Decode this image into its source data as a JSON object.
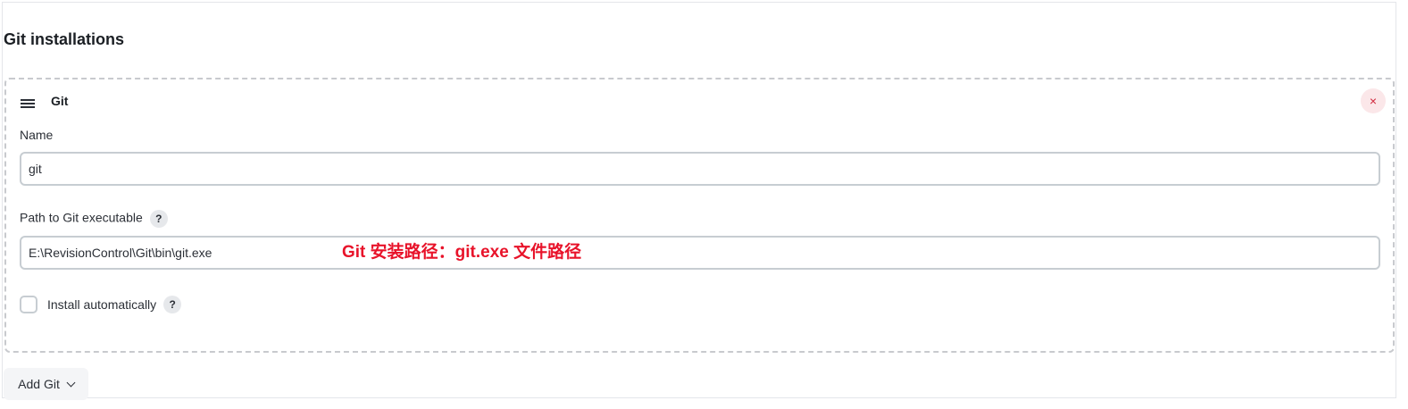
{
  "section": {
    "title": "Git installations"
  },
  "item": {
    "title": "Git",
    "delete_symbol": "×",
    "name": {
      "label": "Name",
      "value": "git"
    },
    "path": {
      "label": "Path to Git executable",
      "help": "?",
      "value": "E:\\RevisionControl\\Git\\bin\\git.exe"
    },
    "install": {
      "label": "Install automatically",
      "help": "?",
      "checked": false
    },
    "annotation": "Git 安装路径：git.exe 文件路径"
  },
  "add_button": {
    "label": "Add Git"
  },
  "colors": {
    "annotation": "#e8132a",
    "delete_icon": "#d0273c",
    "delete_bg": "#fbe7e9",
    "border": "#c7cdd2"
  },
  "icons": {
    "drag": "drag-handle-icon",
    "delete": "close-icon",
    "help": "help-icon",
    "dropdown": "chevron-down-icon"
  }
}
